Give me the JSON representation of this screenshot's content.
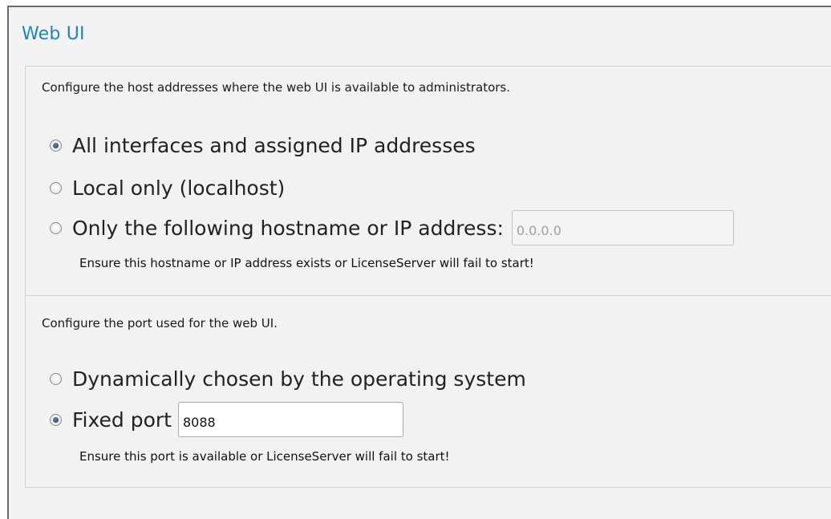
{
  "section": {
    "title": "Web UI"
  },
  "host": {
    "description": "Configure the host addresses where the web UI is available to administrators.",
    "options": [
      {
        "label": "All interfaces and assigned IP addresses",
        "selected": true
      },
      {
        "label": "Local only (localhost)",
        "selected": false
      },
      {
        "label": "Only the following hostname or IP address:",
        "selected": false
      }
    ],
    "address_value": "0.0.0.0",
    "warning": "Ensure this hostname or IP address exists or LicenseServer will fail to start!"
  },
  "port": {
    "description": "Configure the port used for the web UI.",
    "options": [
      {
        "label": "Dynamically chosen by the operating system",
        "selected": false
      },
      {
        "label": "Fixed port",
        "selected": true
      }
    ],
    "port_value": "8088",
    "warning": "Ensure this port is available or LicenseServer will fail to start!"
  }
}
